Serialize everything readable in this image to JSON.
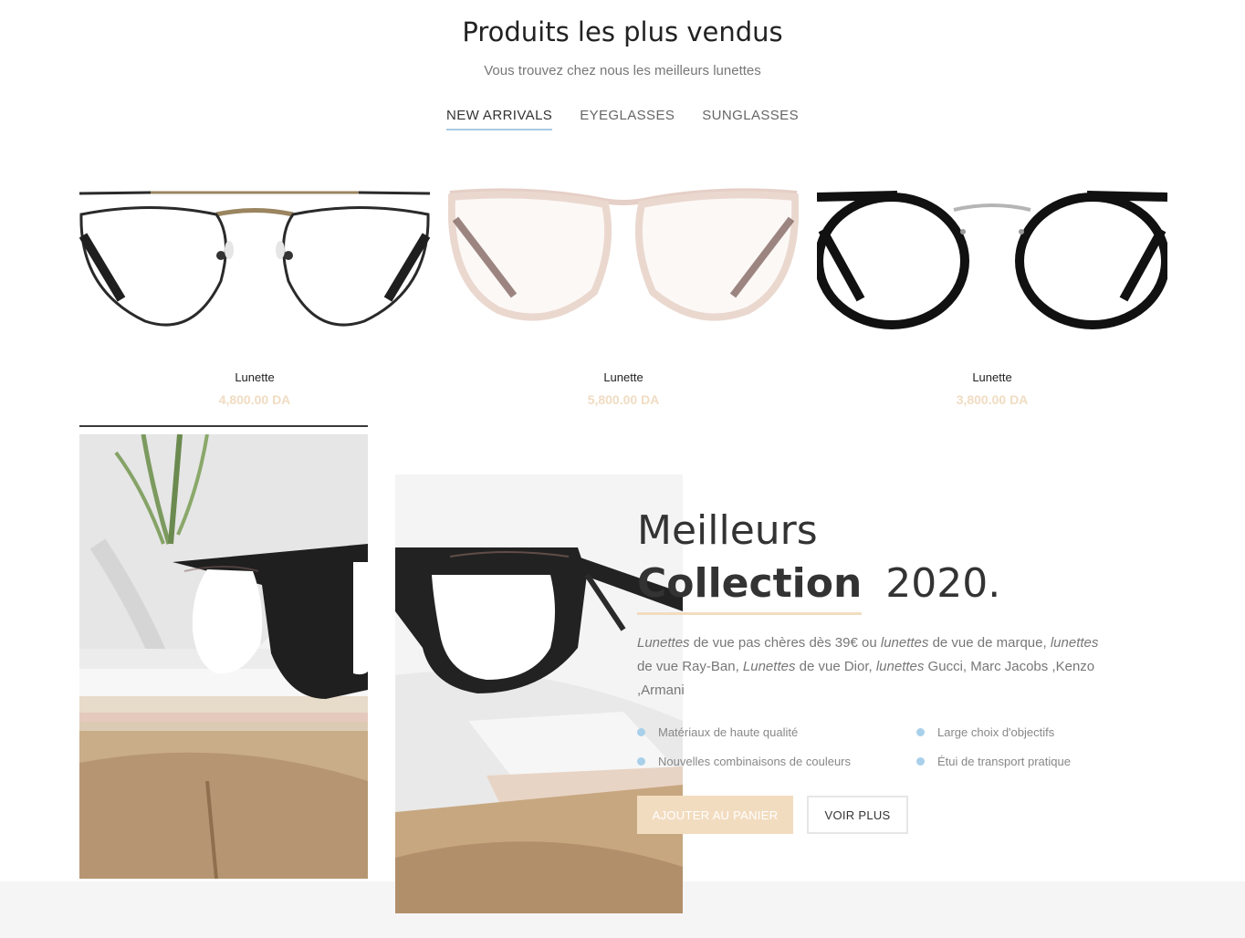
{
  "header": {
    "title": "Produits les plus vendus",
    "subtitle": "Vous trouvez chez nous les meilleurs lunettes"
  },
  "tabs": [
    {
      "label": "NEW ARRIVALS",
      "active": true
    },
    {
      "label": "EYEGLASSES",
      "active": false
    },
    {
      "label": "SUNGLASSES",
      "active": false
    }
  ],
  "products": [
    {
      "name": "Lunette",
      "price": "4,800.00 DA",
      "image": "aviator-metal-glasses"
    },
    {
      "name": "Lunette",
      "price": "5,800.00 DA",
      "image": "pink-transparent-glasses"
    },
    {
      "name": "Lunette",
      "price": "3,800.00 DA",
      "image": "round-black-glasses"
    }
  ],
  "banner": {
    "title_line1": "Meilleurs",
    "title_strong": "Collection",
    "title_year": "2020.",
    "description": [
      {
        "text": "Lunettes",
        "italic": true
      },
      {
        "text": " de vue pas chères dès 39€ ou ",
        "italic": false
      },
      {
        "text": "lunettes",
        "italic": true
      },
      {
        "text": " de vue de marque, ",
        "italic": false
      },
      {
        "text": "lunettes",
        "italic": true
      },
      {
        "text": " de vue Ray-Ban, ",
        "italic": false
      },
      {
        "text": "Lunettes",
        "italic": true
      },
      {
        "text": " de vue Dior, ",
        "italic": false
      },
      {
        "text": "lunettes",
        "italic": true
      },
      {
        "text": " Gucci, Marc Jacobs ,Kenzo ,Armani",
        "italic": false
      }
    ],
    "features": [
      "Matériaux de haute qualité",
      "Large choix d'objectifs",
      "Nouvelles combinaisons de couleurs",
      "Étui de transport pratique"
    ],
    "cart_button": "AJOUTER AU PANIER",
    "more_button": "VOIR PLUS"
  },
  "colors": {
    "accent_peach": "#f2dcc0",
    "price_color": "#f0dcc2",
    "tab_underline": "#a9cbe3",
    "feature_dot": "#a9d0ea"
  }
}
